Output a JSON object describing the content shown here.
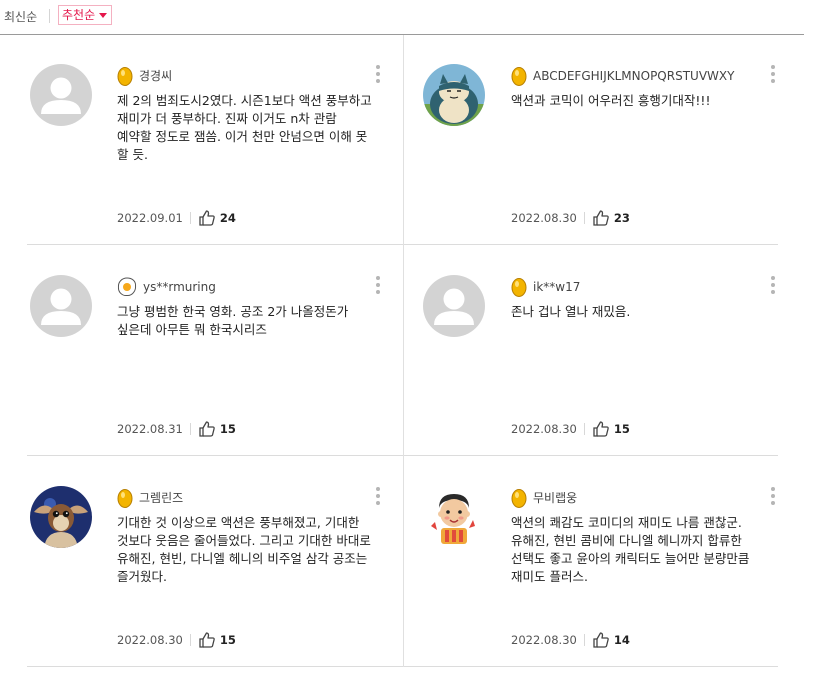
{
  "sort": {
    "latest_label": "최신순",
    "recommended_label": "추천순",
    "active": "recommended",
    "accent_color": "#e4174b"
  },
  "comments": [
    {
      "avatar": "default-profile",
      "badge": "gold-egg-badge",
      "nickname": "경경씨",
      "text": "제 2의 범죄도시2였다. 시즌1보다 액션 풍부하고 재미가 더 풍부하다. 진짜 이거도 n차 관람 예약할 정도로 잼씀. 이거 천만 안넘으면 이해 못 할 듯.",
      "date": "2022.09.01",
      "likes": "24"
    },
    {
      "avatar": "snorlax-profile",
      "badge": "gold-egg-badge",
      "nickname": "ABCDEFGHIJKLMNOPQRSTUVWXY",
      "text": "액션과 코믹이 어우러진 흥행기대작!!!",
      "date": "2022.08.30",
      "likes": "23"
    },
    {
      "avatar": "default-profile",
      "badge": "fried-egg-badge",
      "nickname": "ys**rmuring",
      "text": "그냥 평범한 한국 영화. 공조 2가 나올정돈가 싶은데 아무튼 뭐 한국시리즈",
      "date": "2022.08.31",
      "likes": "15"
    },
    {
      "avatar": "default-profile",
      "badge": "gold-egg-badge",
      "nickname": "ik**w17",
      "text": "존나 겁나 열나 재밌음.",
      "date": "2022.08.30",
      "likes": "15"
    },
    {
      "avatar": "gremlin-profile",
      "badge": "gold-egg-badge",
      "nickname": "그렘린즈",
      "text": "기대한 것 이상으로 액션은 풍부해졌고, 기대한 것보다 웃음은 줄어들었다. 그리고 기대한 바대로 유해진, 현빈, 다니엘 헤니의 비주얼 삼각 공조는 즐거웠다.",
      "date": "2022.08.30",
      "likes": "15"
    },
    {
      "avatar": "cartoon-boy-profile",
      "badge": "gold-egg-badge",
      "nickname": "무비랩웅",
      "text": "액션의 쾌감도 코미디의 재미도 나름 괜찮군. 유해진, 현빈 콤비에 다니엘 헤니까지 합류한 선택도 좋고 윤아의 캐릭터도 늘어만 분량만큼 재미도 플러스.",
      "date": "2022.08.30",
      "likes": "14"
    }
  ]
}
